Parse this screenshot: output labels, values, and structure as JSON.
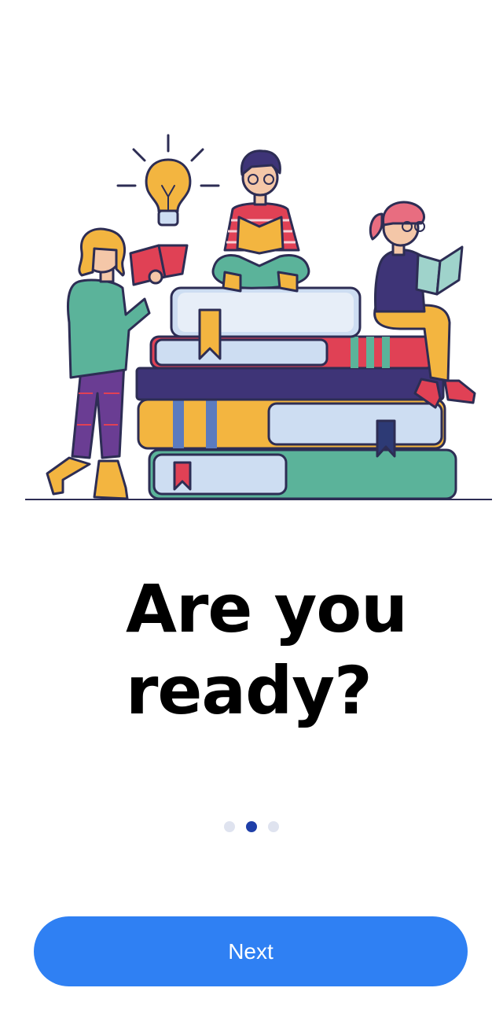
{
  "onboarding": {
    "headline_line1": "Are you",
    "headline_line2": "ready?",
    "pager": {
      "total_pages": 3,
      "active_page": 2
    },
    "next_label": "Next"
  },
  "colors": {
    "primary_button": "#2f80f3",
    "pager_active": "#1f3fa8",
    "pager_inactive": "#dfe3ef"
  },
  "icons": {
    "illustration": "people-reading-on-books-illustration",
    "lightbulb": "lightbulb-icon"
  }
}
